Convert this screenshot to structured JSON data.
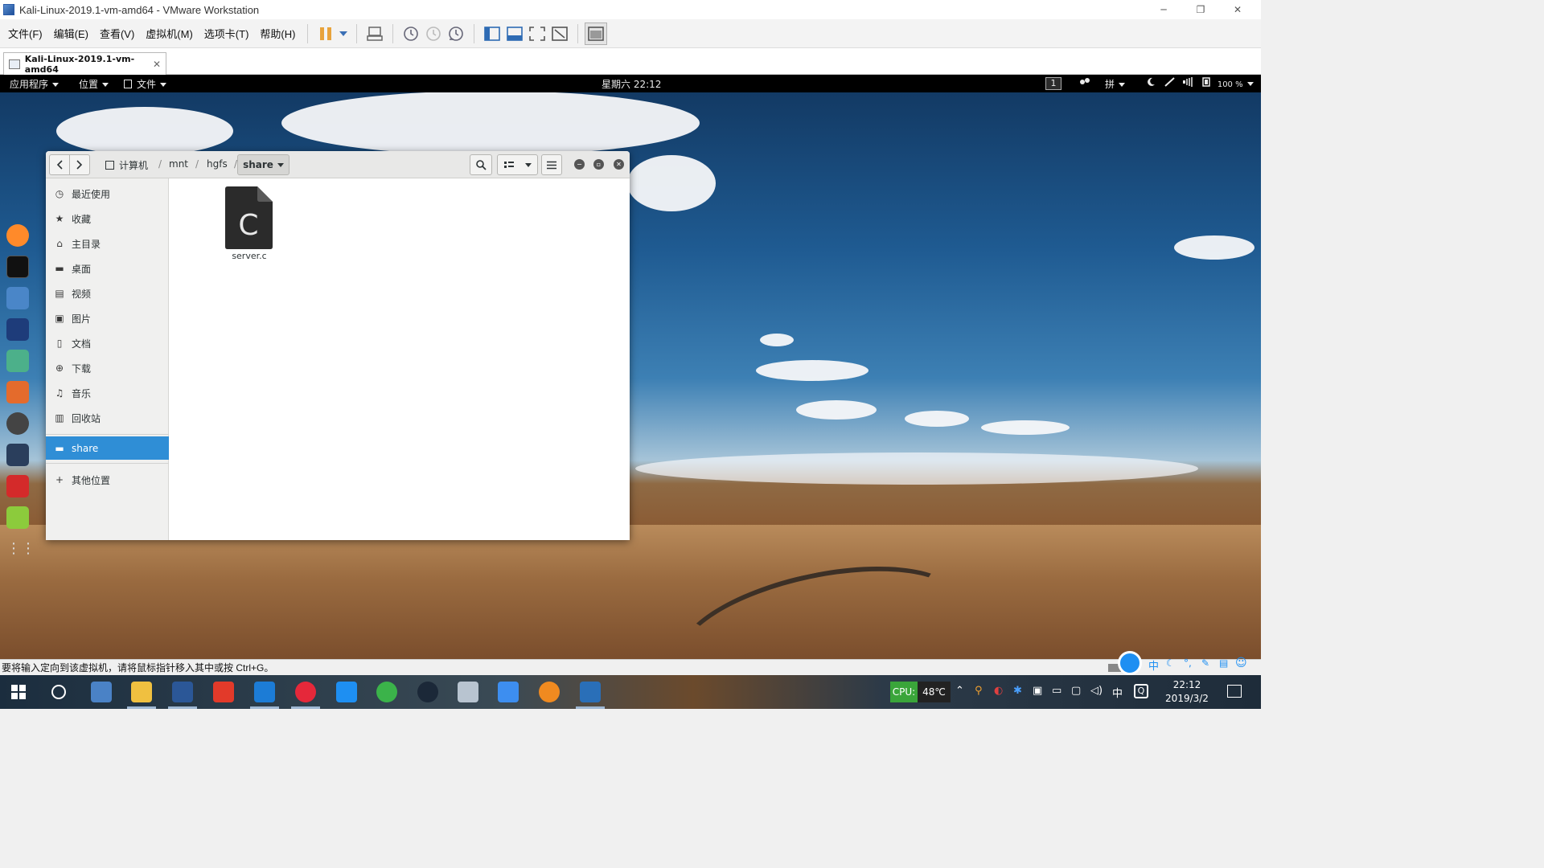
{
  "window": {
    "title": "Kali-Linux-2019.1-vm-amd64 - VMware Workstation",
    "minimize": "─",
    "restore": "❐",
    "close": "✕"
  },
  "menu": [
    "文件(F)",
    "编辑(E)",
    "查看(V)",
    "虚拟机(M)",
    "选项卡(T)",
    "帮助(H)"
  ],
  "vm_tab": {
    "label": "Kali-Linux-2019.1-vm-amd64",
    "close": "✕"
  },
  "gnome": {
    "apps": "应用程序",
    "places": "位置",
    "files": "文件",
    "clock": "星期六 22:12",
    "workspace": "1",
    "input": "拼",
    "battery": "100 %"
  },
  "fm": {
    "breadcrumbs": [
      "计算机",
      "mnt",
      "hgfs",
      "share"
    ],
    "sidebar": [
      {
        "label": "最近使用",
        "icon": "clock-icon",
        "glyph": "◷"
      },
      {
        "label": "收藏",
        "icon": "star-icon",
        "glyph": "★"
      },
      {
        "label": "主目录",
        "icon": "home-icon",
        "glyph": "⌂"
      },
      {
        "label": "桌面",
        "icon": "folder-icon",
        "glyph": "▬"
      },
      {
        "label": "视频",
        "icon": "film-icon",
        "glyph": "▤"
      },
      {
        "label": "图片",
        "icon": "image-icon",
        "glyph": "▣"
      },
      {
        "label": "文档",
        "icon": "document-icon",
        "glyph": "▯"
      },
      {
        "label": "下载",
        "icon": "download-icon",
        "glyph": "⊕"
      },
      {
        "label": "音乐",
        "icon": "music-icon",
        "glyph": "♫"
      },
      {
        "label": "回收站",
        "icon": "trash-icon",
        "glyph": "▥"
      }
    ],
    "bookmark": {
      "label": "share",
      "glyph": "▬"
    },
    "other": {
      "label": "其他位置",
      "glyph": "+"
    },
    "file": {
      "name": "server.c",
      "letter": "C"
    }
  },
  "status_text": "要将输入定向到该虚拟机，请将鼠标指针移入其中或按 Ctrl+G。",
  "taskbar": {
    "cpu_label": "CPU:",
    "cpu_temp": "48℃",
    "time": "22:12",
    "date": "2019/3/2",
    "ime": "中",
    "ime_tray": "中"
  }
}
